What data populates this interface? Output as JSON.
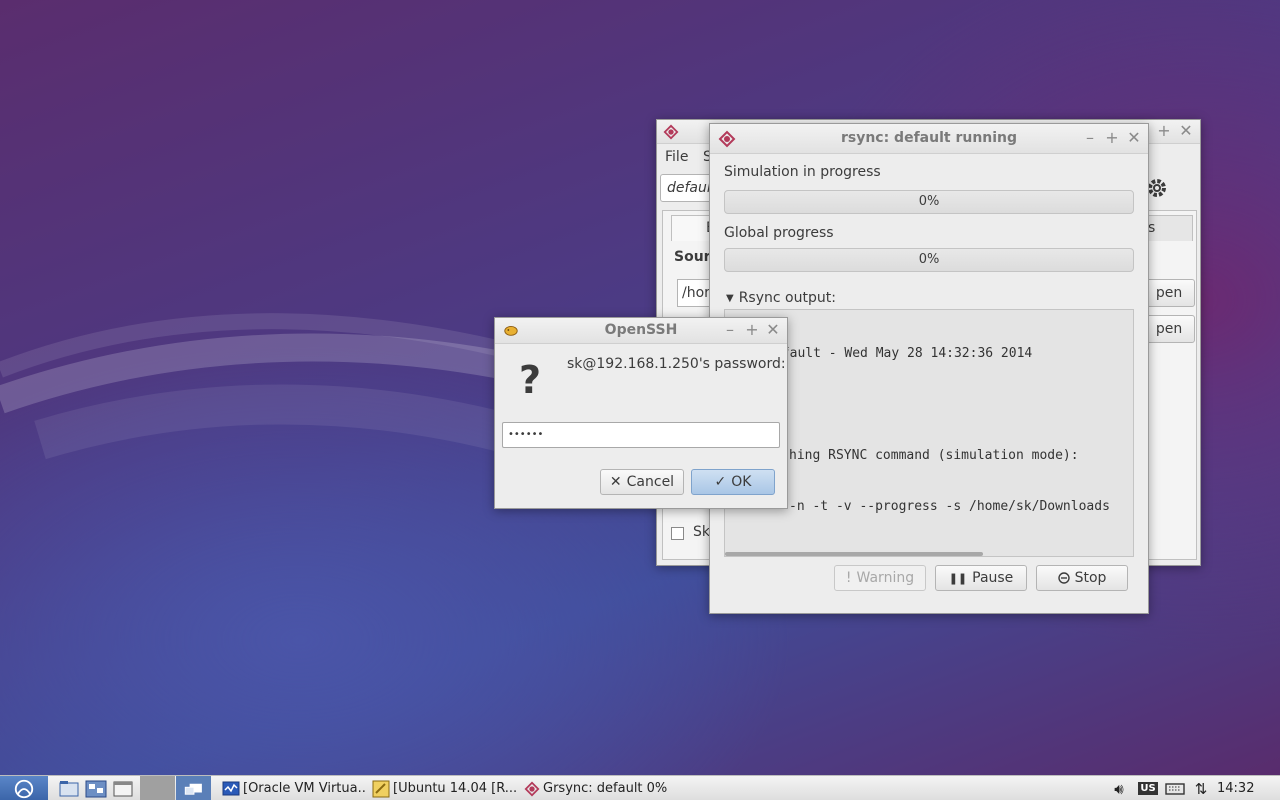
{
  "background_window": {
    "menu": [
      "File",
      "S"
    ],
    "profile_value": "defaul",
    "tab_label": "E",
    "tab_right_label": "s",
    "source_label": "Sourc",
    "source_path": "/hor",
    "open_button_1": "pen",
    "open_button_2": "pen",
    "checkbox_label_partial": "Sk"
  },
  "rsync_window": {
    "title": "rsync: default running",
    "simulation_label": "Simulation in progress",
    "simulation_progress_text": "0%",
    "simulation_progress": 0,
    "global_label": "Global progress",
    "global_progress_text": "0%",
    "global_progress": 0,
    "output_label": "Rsync output:",
    "output_lines": [
      "**** default - Wed May 28 14:32:36 2014",
      "",
      "hing RSYNC command (simulation mode):",
      "-n -t -v --progress -s /home/sk/Downloads"
    ],
    "warning_label": "Warning",
    "pause_label": "Pause",
    "stop_label": "Stop"
  },
  "openssh_dialog": {
    "title": "OpenSSH",
    "prompt": "sk@192.168.1.250's password:",
    "password_value": "••••••",
    "cancel_label": "Cancel",
    "ok_label": "OK"
  },
  "taskbar": {
    "tasks": [
      {
        "label": "[Oracle VM Virtua..."
      },
      {
        "label": "[Ubuntu 14.04 [R..."
      },
      {
        "label": "Grsync: default 0%"
      }
    ],
    "keyboard_layout": "US",
    "clock": "14:32"
  },
  "colors": {
    "progress_fill": "#8ab0da",
    "ok_button": "#a9c6e6"
  }
}
